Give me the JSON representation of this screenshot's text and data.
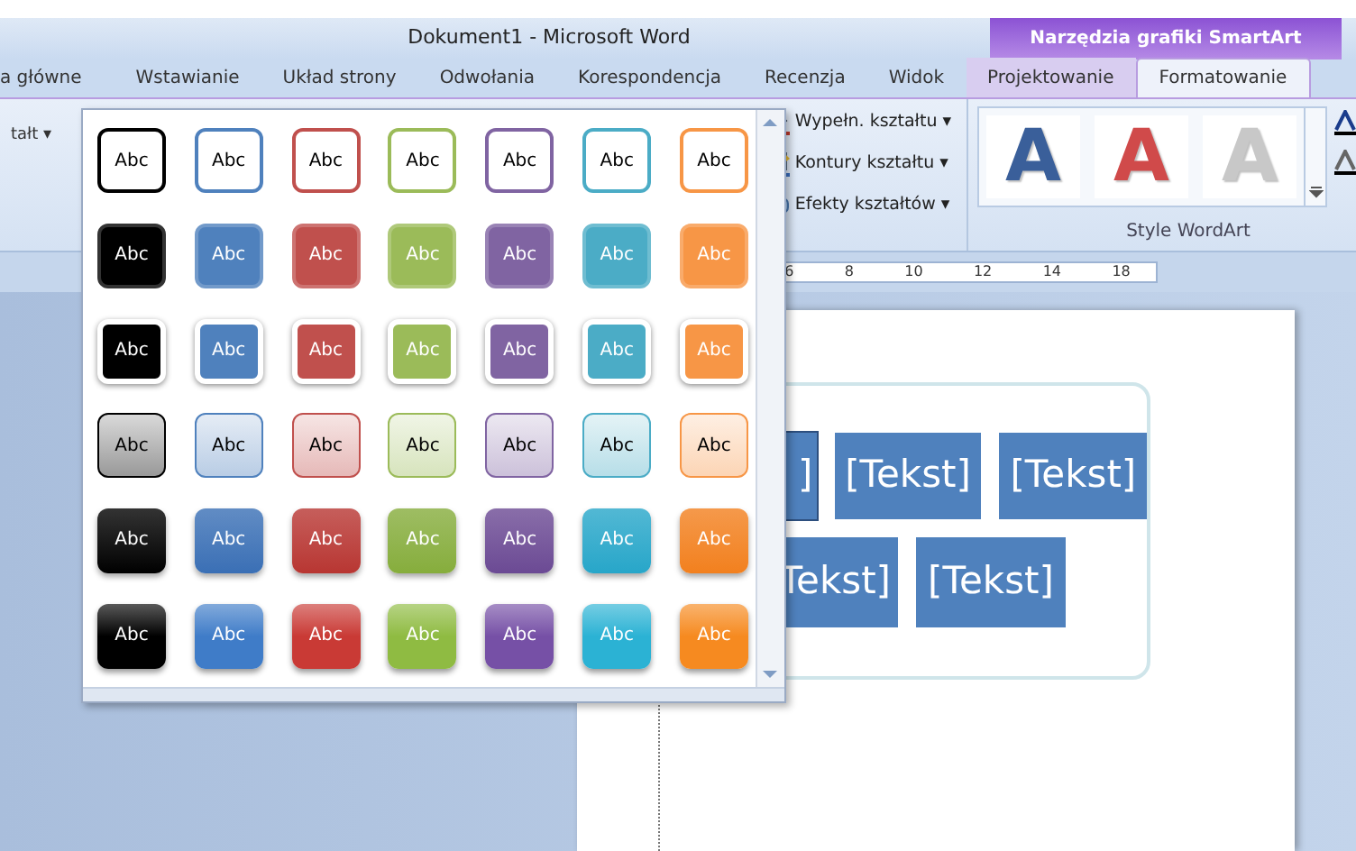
{
  "window": {
    "title": "Dokument1  -  Microsoft Word",
    "context_title": "Narzędzia grafiki SmartArt"
  },
  "tabs": [
    {
      "label": "a główne",
      "selected": false,
      "contextual": false
    },
    {
      "label": "Wstawianie",
      "selected": false,
      "contextual": false
    },
    {
      "label": "Układ strony",
      "selected": false,
      "contextual": false
    },
    {
      "label": "Odwołania",
      "selected": false,
      "contextual": false
    },
    {
      "label": "Korespondencja",
      "selected": false,
      "contextual": false
    },
    {
      "label": "Recenzja",
      "selected": false,
      "contextual": false
    },
    {
      "label": "Widok",
      "selected": false,
      "contextual": false
    },
    {
      "label": "Projektowanie",
      "selected": false,
      "contextual": true
    },
    {
      "label": "Formatowanie",
      "selected": true,
      "contextual": true
    }
  ],
  "ribbon": {
    "left_label": "tałt ▾",
    "commands": [
      {
        "label": "Wypełn. kształtu ▾",
        "kind": "fill"
      },
      {
        "label": "Kontury kształtu ▾",
        "kind": "outline"
      },
      {
        "label": "Efekty kształtów ▾",
        "kind": "effects"
      }
    ],
    "wordart": {
      "title": "Style WordArt",
      "styles": [
        {
          "label": "A",
          "color": "#3a5f9a"
        },
        {
          "label": "A",
          "color": "#d04a4a"
        },
        {
          "label": "A",
          "color": "#c8c8c8"
        }
      ]
    }
  },
  "ruler": [
    "6",
    "8",
    "10",
    "12",
    "14",
    "18"
  ],
  "gallery": {
    "rows": [
      {
        "kind": "outline",
        "items": [
          {
            "label": "Abc",
            "color": "#000000"
          },
          {
            "label": "Abc",
            "color": "#4f81bd"
          },
          {
            "label": "Abc",
            "color": "#c0504d"
          },
          {
            "label": "Abc",
            "color": "#9bbb59"
          },
          {
            "label": "Abc",
            "color": "#8064a2"
          },
          {
            "label": "Abc",
            "color": "#4bacc6"
          },
          {
            "label": "Abc",
            "color": "#f79646"
          }
        ]
      },
      {
        "kind": "filled",
        "items": [
          {
            "label": "Abc",
            "color": "#000000"
          },
          {
            "label": "Abc",
            "color": "#4f81bd"
          },
          {
            "label": "Abc",
            "color": "#c0504d"
          },
          {
            "label": "Abc",
            "color": "#9bbb59"
          },
          {
            "label": "Abc",
            "color": "#8064a2"
          },
          {
            "label": "Abc",
            "color": "#4bacc6"
          },
          {
            "label": "Abc",
            "color": "#f79646"
          }
        ]
      },
      {
        "kind": "raised",
        "items": [
          {
            "label": "Abc",
            "color": "#000000"
          },
          {
            "label": "Abc",
            "color": "#4f81bd"
          },
          {
            "label": "Abc",
            "color": "#c0504d"
          },
          {
            "label": "Abc",
            "color": "#9bbb59"
          },
          {
            "label": "Abc",
            "color": "#8064a2"
          },
          {
            "label": "Abc",
            "color": "#4bacc6"
          },
          {
            "label": "Abc",
            "color": "#f79646"
          }
        ]
      },
      {
        "kind": "light",
        "items": [
          {
            "label": "Abc",
            "color": "#000000"
          },
          {
            "label": "Abc",
            "color": "#4f81bd"
          },
          {
            "label": "Abc",
            "color": "#c0504d"
          },
          {
            "label": "Abc",
            "color": "#9bbb59"
          },
          {
            "label": "Abc",
            "color": "#8064a2"
          },
          {
            "label": "Abc",
            "color": "#4bacc6"
          },
          {
            "label": "Abc",
            "color": "#f79646"
          }
        ]
      },
      {
        "kind": "gradient",
        "items": [
          {
            "label": "Abc",
            "color": "#000000"
          },
          {
            "label": "Abc",
            "color": "#3a6fb5"
          },
          {
            "label": "Abc",
            "color": "#b83632"
          },
          {
            "label": "Abc",
            "color": "#86ad3c"
          },
          {
            "label": "Abc",
            "color": "#6b4a94"
          },
          {
            "label": "Abc",
            "color": "#27a6c9"
          },
          {
            "label": "Abc",
            "color": "#f2801e"
          }
        ]
      },
      {
        "kind": "glossy",
        "items": [
          {
            "label": "Abc",
            "color": "#000000"
          },
          {
            "label": "Abc",
            "color": "#3f7cc8"
          },
          {
            "label": "Abc",
            "color": "#c93a35"
          },
          {
            "label": "Abc",
            "color": "#8fbb42"
          },
          {
            "label": "Abc",
            "color": "#7650a6"
          },
          {
            "label": "Abc",
            "color": "#2bb2d4"
          },
          {
            "label": "Abc",
            "color": "#f68a20"
          }
        ]
      }
    ]
  },
  "smartart": {
    "rows": [
      [
        "]",
        "[Tekst]",
        "[Tekst]"
      ],
      [
        "Tekst]",
        "[Tekst]"
      ]
    ]
  }
}
